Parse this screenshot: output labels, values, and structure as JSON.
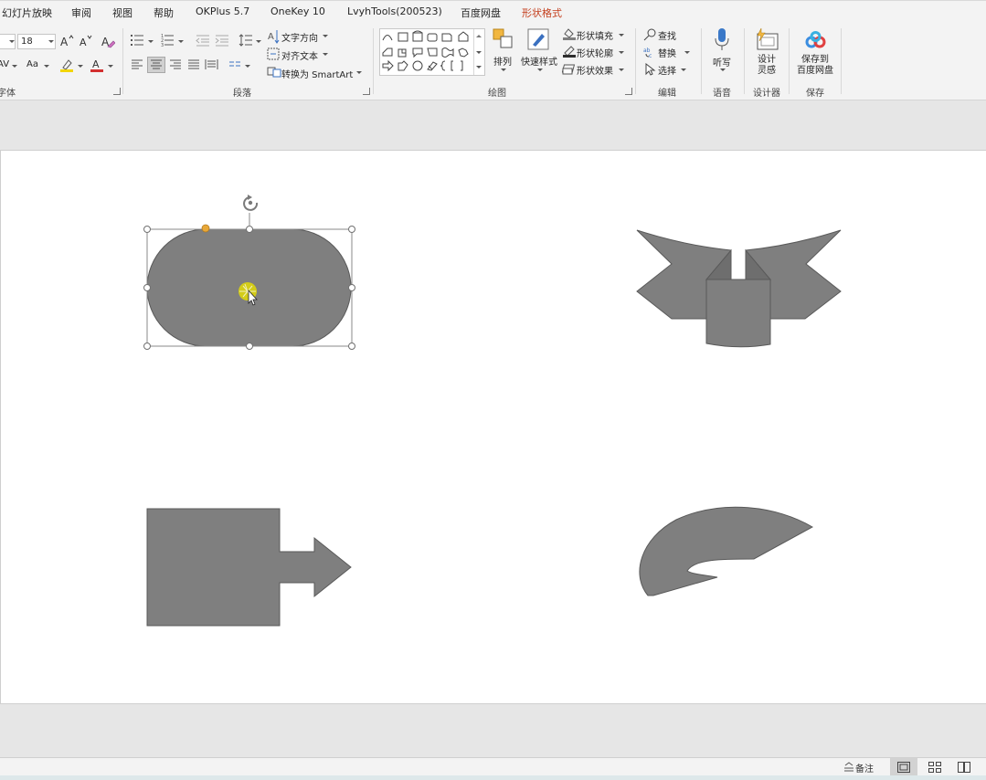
{
  "tabs": [
    {
      "label": "幻灯片放映",
      "active": false
    },
    {
      "label": "审阅",
      "active": false
    },
    {
      "label": "视图",
      "active": false
    },
    {
      "label": "帮助",
      "active": false
    },
    {
      "label": "OKPlus 5.7",
      "active": false
    },
    {
      "label": "OneKey 10",
      "active": false
    },
    {
      "label": "LvyhTools(200523)",
      "active": false
    },
    {
      "label": "百度网盘",
      "active": false
    },
    {
      "label": "形状格式",
      "active": true
    }
  ],
  "font_group": {
    "label": "字体",
    "font_name_value": "",
    "font_size_value": "18",
    "increase_font_icon": "A^",
    "decrease_font_icon": "Aˇ",
    "clear_format_icon": "clear-format",
    "char_spacing_label": "AV",
    "change_case_label": "Aa",
    "highlight_color": "#f2d500",
    "font_color": "#d32f2f"
  },
  "paragraph_group": {
    "label": "段落",
    "text_direction": "文字方向",
    "align_text": "对齐文本",
    "convert_smartart": "转换为 SmartArt"
  },
  "drawing_group": {
    "label": "绘图",
    "arrange": "排列",
    "quick_styles": "快速样式",
    "shape_fill": "形状填充",
    "shape_outline": "形状轮廓",
    "shape_effects": "形状效果",
    "fill_color": "#7f7f7f"
  },
  "editing_group": {
    "label": "编辑",
    "find": "查找",
    "replace": "替换",
    "select": "选择"
  },
  "voice_group": {
    "label": "语音",
    "dictate": "听写"
  },
  "designer_group": {
    "label": "设计器",
    "design_ideas": "设计\n灵感"
  },
  "save_group": {
    "label": "保存",
    "save_to_baidu": "保存到\n百度网盘"
  },
  "slide": {
    "shape_fill": "#7f7f7f",
    "shape_outline": "#595959",
    "adjust_handle_color": "#e8a838",
    "cursor_highlight": "#e8e000"
  },
  "status": {
    "notes": "备注"
  }
}
